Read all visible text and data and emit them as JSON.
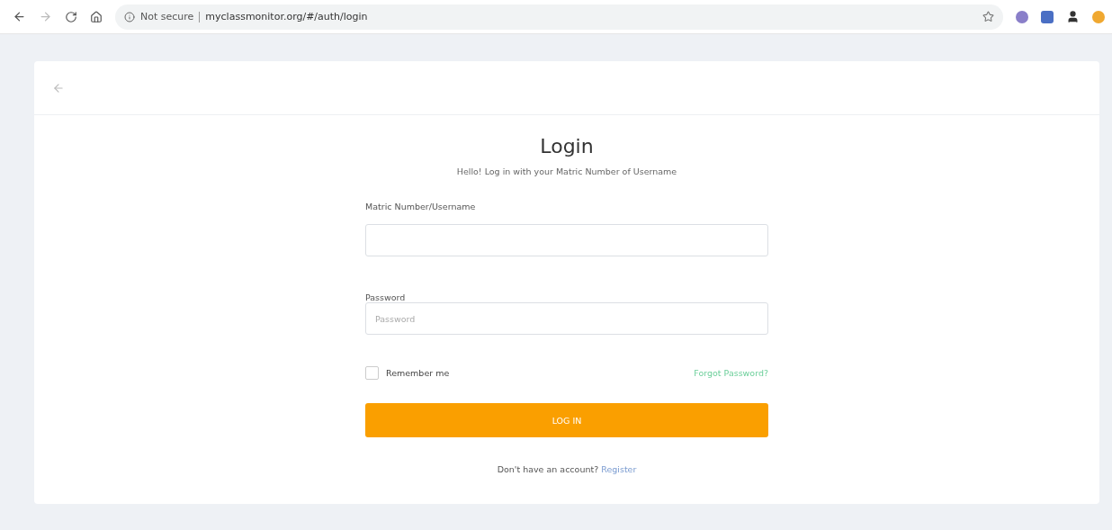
{
  "browser": {
    "security": "Not secure",
    "url": "myclassmonitor.org/#/auth/login"
  },
  "title": "Login",
  "subtitle": "Hello! Log in with your Matric Number of Username",
  "fields": [
    {
      "label": "Matric Number/Username"
    },
    {
      "label": "Password",
      "placeholder": "Password"
    }
  ],
  "remember": {
    "label": "Remember me",
    "checked": false
  },
  "forgot": "Forgot Password?",
  "submit": "LOG IN",
  "register": {
    "prompt": "Don't have an account?",
    "link": "Register"
  }
}
